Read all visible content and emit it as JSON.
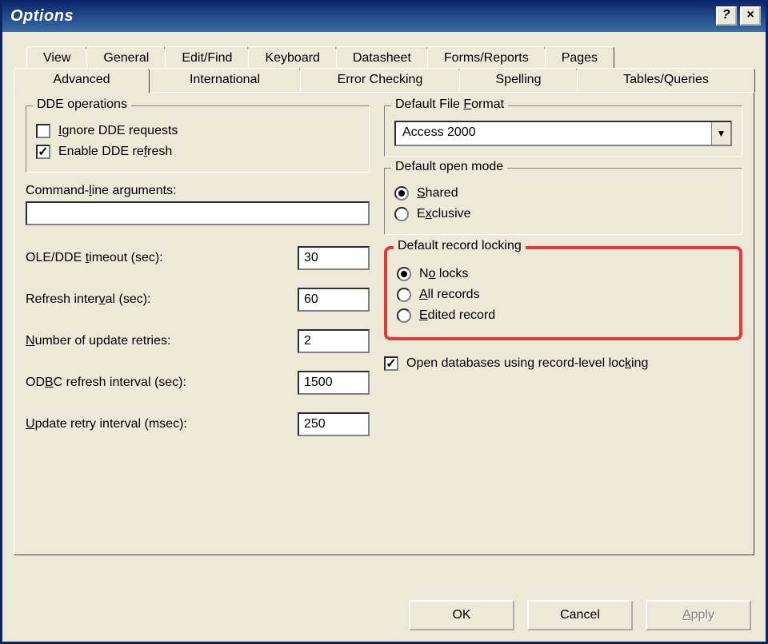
{
  "window": {
    "title": "Options"
  },
  "titlebar_buttons": {
    "help": "?",
    "close": "×"
  },
  "tabs_row1": [
    {
      "label": "View"
    },
    {
      "label": "General"
    },
    {
      "label": "Edit/Find"
    },
    {
      "label": "Keyboard"
    },
    {
      "label": "Datasheet"
    },
    {
      "label": "Forms/Reports"
    },
    {
      "label": "Pages"
    }
  ],
  "tabs_row2": [
    {
      "label": "Advanced",
      "active": true
    },
    {
      "label": "International"
    },
    {
      "label": "Error Checking"
    },
    {
      "label": "Spelling"
    },
    {
      "label": "Tables/Queries"
    }
  ],
  "dde": {
    "legend": "DDE operations",
    "ignore_label": "Ignore DDE requests",
    "ignore_checked": false,
    "enable_label": "Enable DDE refresh",
    "enable_checked": true
  },
  "cmdline": {
    "label": "Command-line arguments:",
    "value": ""
  },
  "numeric": {
    "ole_timeout_label": "OLE/DDE timeout (sec):",
    "ole_timeout_value": "30",
    "refresh_interval_label": "Refresh interval (sec):",
    "refresh_interval_value": "60",
    "update_retries_label": "Number of update retries:",
    "update_retries_value": "2",
    "odbc_refresh_label": "ODBC refresh interval (sec):",
    "odbc_refresh_value": "1500",
    "retry_interval_label": "Update retry interval (msec):",
    "retry_interval_value": "250"
  },
  "file_format": {
    "legend": "Default File Format",
    "selected": "Access 2000"
  },
  "open_mode": {
    "legend": "Default open mode",
    "shared_label": "Shared",
    "exclusive_label": "Exclusive",
    "selected": "shared"
  },
  "record_locking": {
    "legend": "Default record locking",
    "no_locks_label": "No locks",
    "all_records_label": "All records",
    "edited_record_label": "Edited record",
    "selected": "no_locks"
  },
  "open_record_level": {
    "label": "Open databases using record-level locking",
    "checked": true
  },
  "buttons": {
    "ok": "OK",
    "cancel": "Cancel",
    "apply": "Apply"
  }
}
